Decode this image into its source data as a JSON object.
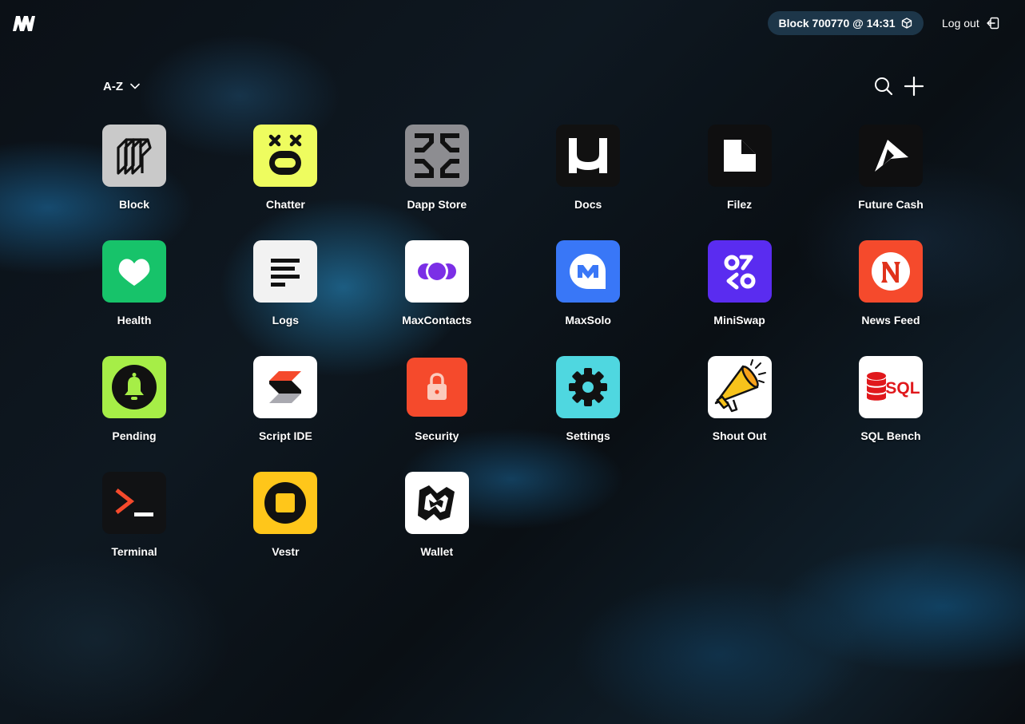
{
  "header": {
    "block_status": "Block 700770 @ 14:31",
    "logout_label": "Log out"
  },
  "toolbar": {
    "sort_label": "A-Z"
  },
  "apps": [
    {
      "label": "Block",
      "icon": "block-icon",
      "bg": "#c9c9c9"
    },
    {
      "label": "Chatter",
      "icon": "chatter-icon",
      "bg": "#eefc5f"
    },
    {
      "label": "Dapp Store",
      "icon": "dapp-store-icon",
      "bg": "#8d8d91"
    },
    {
      "label": "Docs",
      "icon": "docs-icon",
      "bg": "#111111"
    },
    {
      "label": "Filez",
      "icon": "filez-icon",
      "bg": "#0f0f10"
    },
    {
      "label": "Future Cash",
      "icon": "future-cash-icon",
      "bg": "#0f0f10"
    },
    {
      "label": "Health",
      "icon": "health-icon",
      "bg": "#17c36a"
    },
    {
      "label": "Logs",
      "icon": "logs-icon",
      "bg": "#f2f2f2"
    },
    {
      "label": "MaxContacts",
      "icon": "maxcontacts-icon",
      "bg": "#ffffff"
    },
    {
      "label": "MaxSolo",
      "icon": "maxsolo-icon",
      "bg": "#3977f7"
    },
    {
      "label": "MiniSwap",
      "icon": "miniswap-icon",
      "bg": "#5a2cf0"
    },
    {
      "label": "News Feed",
      "icon": "news-feed-icon",
      "bg": "#f54a2c"
    },
    {
      "label": "Pending",
      "icon": "pending-icon",
      "bg": "#a6ee47"
    },
    {
      "label": "Script IDE",
      "icon": "script-ide-icon",
      "bg": "#ffffff"
    },
    {
      "label": "Security",
      "icon": "security-icon",
      "bg": "#f54a2c"
    },
    {
      "label": "Settings",
      "icon": "settings-icon",
      "bg": "#4fd7e0"
    },
    {
      "label": "Shout Out",
      "icon": "shout-out-icon",
      "bg": "#ffffff"
    },
    {
      "label": "SQL Bench",
      "icon": "sql-bench-icon",
      "bg": "#ffffff",
      "text": "SQL"
    },
    {
      "label": "Terminal",
      "icon": "terminal-icon",
      "bg": "#111214"
    },
    {
      "label": "Vestr",
      "icon": "vestr-icon",
      "bg": "#ffc61a"
    },
    {
      "label": "Wallet",
      "icon": "wallet-icon",
      "bg": "#ffffff"
    }
  ]
}
